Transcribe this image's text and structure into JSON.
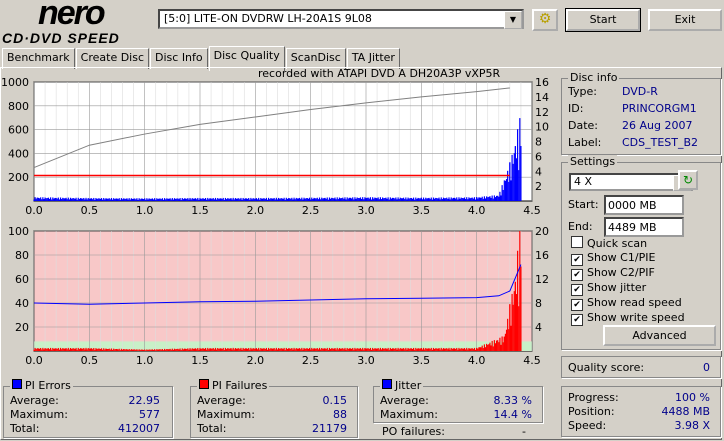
{
  "logo": {
    "brand": "nero",
    "product": "CD·DVD SPEED"
  },
  "drive": {
    "selected": "[5:0]  LITE-ON DVDRW LH-20A1S 9L08"
  },
  "buttons": {
    "start": "Start",
    "exit": "Exit",
    "advanced": "Advanced"
  },
  "tabs": [
    "Benchmark",
    "Create Disc",
    "Disc Info",
    "Disc Quality",
    "ScanDisc",
    "TA Jitter"
  ],
  "active_tab": "Disc Quality",
  "recorded_with": "recorded with ATAPI   DVD A   DH20A3P   vXP5R",
  "disc_info": {
    "title": "Disc info",
    "type_label": "Type:",
    "type": "DVD-R",
    "id_label": "ID:",
    "id": "PRINCORGM1",
    "date_label": "Date:",
    "date": "26 Aug 2007",
    "label_label": "Label:",
    "label": "CDS_TEST_B2"
  },
  "settings": {
    "title": "Settings",
    "speed": "4 X",
    "start_label": "Start:",
    "start": "0000 MB",
    "end_label": "End:",
    "end": "4489 MB",
    "checks": [
      {
        "label": "Quick scan",
        "checked": false
      },
      {
        "label": "Show C1/PIE",
        "checked": true
      },
      {
        "label": "Show C2/PIF",
        "checked": true
      },
      {
        "label": "Show jitter",
        "checked": true
      },
      {
        "label": "Show read speed",
        "checked": true
      },
      {
        "label": "Show write speed",
        "checked": true
      }
    ]
  },
  "quality": {
    "label": "Quality score:",
    "value": "0"
  },
  "pi_errors": {
    "title": "PI Errors",
    "color": "#0000ff",
    "avg_label": "Average:",
    "avg": "22.95",
    "max_label": "Maximum:",
    "max": "577",
    "total_label": "Total:",
    "total": "412007"
  },
  "pi_failures": {
    "title": "PI Failures",
    "color": "#ff0000",
    "avg_label": "Average:",
    "avg": "0.15",
    "max_label": "Maximum:",
    "max": "88",
    "total_label": "Total:",
    "total": "21179"
  },
  "jitter": {
    "title": "Jitter",
    "color": "#0000ff",
    "avg_label": "Average:",
    "avg": "8.33 %",
    "max_label": "Maximum:",
    "max": "14.4 %",
    "po_label": "PO failures:",
    "po": "-"
  },
  "progress": {
    "progress_label": "Progress:",
    "progress": "100 %",
    "position_label": "Position:",
    "position": "4488 MB",
    "speed_label": "Speed:",
    "speed": "3.98 X"
  },
  "chart_data": [
    {
      "type": "bar",
      "series": [
        {
          "name": "PI Errors",
          "color": "#0000ff",
          "x": [
            0,
            0.5,
            1,
            1.5,
            2,
            2.5,
            3,
            3.5,
            4,
            4.2,
            4.3,
            4.35,
            4.4
          ],
          "y": [
            25,
            20,
            18,
            20,
            20,
            22,
            25,
            22,
            25,
            40,
            250,
            400,
            577
          ]
        },
        {
          "name": "read speed",
          "color": "#808080",
          "x": [
            0,
            0.5,
            1,
            1.5,
            2,
            2.5,
            3,
            3.5,
            4,
            4.3
          ],
          "y": [
            4.5,
            7.5,
            9,
            10.3,
            11.3,
            12.3,
            13.2,
            14,
            14.7,
            15.2
          ]
        }
      ],
      "xlim": [
        0,
        4.5
      ],
      "ylim": [
        0,
        1000
      ],
      "y2lim": [
        0,
        16
      ],
      "xticks": [
        "0.0",
        "0.5",
        "1.0",
        "1.5",
        "2.0",
        "2.5",
        "3.0",
        "3.5",
        "4.0",
        "4.5"
      ],
      "yticks": [
        "200",
        "400",
        "600",
        "800",
        "1000"
      ],
      "y2ticks": [
        "2",
        "4",
        "6",
        "8",
        "10",
        "12",
        "14",
        "16"
      ],
      "grid": true
    },
    {
      "type": "bar",
      "series": [
        {
          "name": "PI Failures",
          "color": "#ff0000",
          "x": [
            0,
            0.5,
            1,
            1.5,
            2,
            2.5,
            3,
            3.5,
            4,
            4.25,
            4.3,
            4.35,
            4.4
          ],
          "y": [
            2,
            2,
            1,
            2,
            2,
            2,
            2,
            2,
            2,
            10,
            30,
            50,
            88
          ]
        },
        {
          "name": "Jitter",
          "color": "#0000ff",
          "x": [
            0,
            0.5,
            1,
            1.5,
            2,
            2.5,
            3,
            3.5,
            4,
            4.2,
            4.3,
            4.4
          ],
          "y": [
            8.0,
            7.8,
            8.0,
            8.2,
            8.3,
            8.5,
            8.7,
            8.8,
            8.9,
            9.2,
            10,
            14.4
          ]
        }
      ],
      "xlim": [
        0,
        4.5
      ],
      "ylim": [
        0,
        100
      ],
      "y2lim": [
        0,
        20
      ],
      "xticks": [
        "0.0",
        "0.5",
        "1.0",
        "1.5",
        "2.0",
        "2.5",
        "3.0",
        "3.5",
        "4.0",
        "4.5"
      ],
      "yticks": [
        "20",
        "40",
        "60",
        "80",
        "100"
      ],
      "y2ticks": [
        "4",
        "8",
        "12",
        "16",
        "20"
      ],
      "grid": true
    }
  ]
}
